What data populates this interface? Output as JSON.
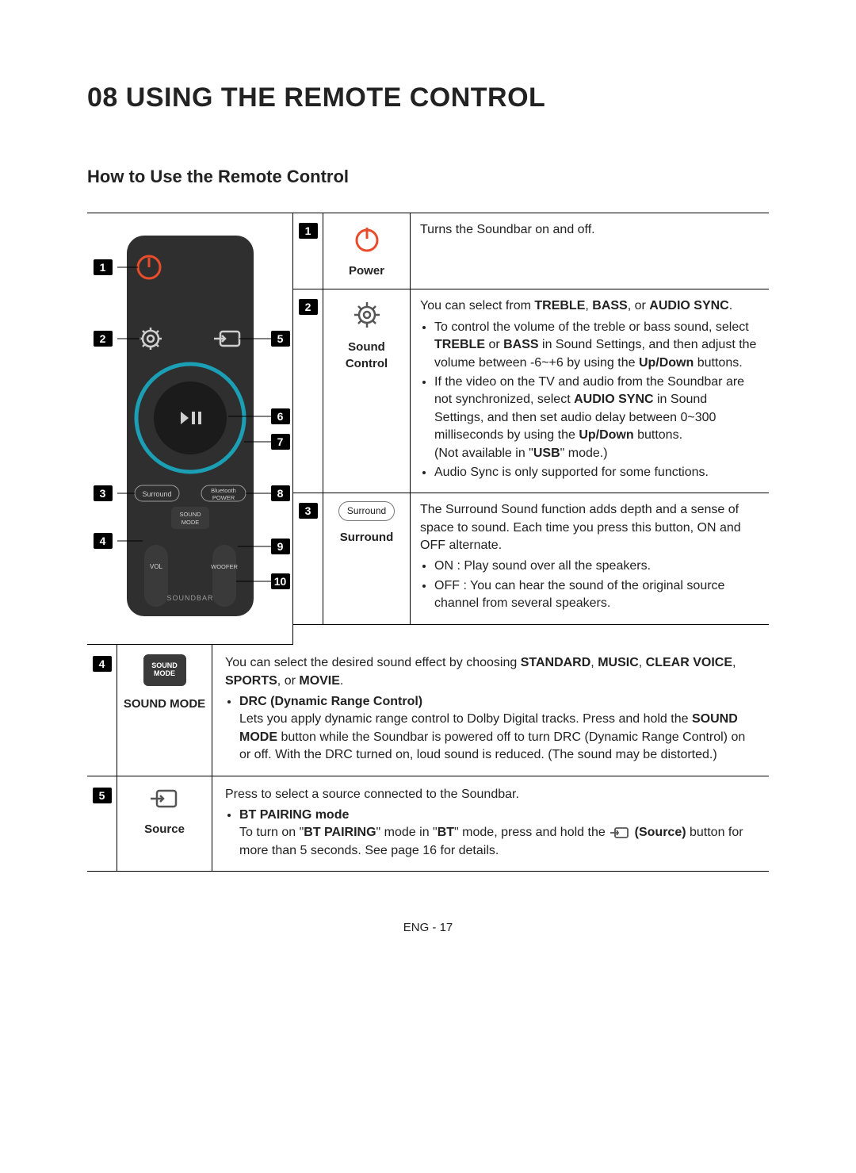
{
  "title": "08 USING THE REMOTE CONTROL",
  "subtitle": "How to Use the Remote Control",
  "remote_labels": {
    "surround": "Surround",
    "bt_power": "Bluetooth POWER",
    "sound_mode": "SOUND MODE",
    "vol": "VOL",
    "woofer": "WOOFER",
    "soundbar": "SOUNDBAR"
  },
  "callouts": {
    "left": [
      "1",
      "2",
      "3",
      "4"
    ],
    "right": [
      "5",
      "6",
      "7",
      "8",
      "9",
      "10"
    ]
  },
  "rows": {
    "r1": {
      "num": "1",
      "label": "Power",
      "text": "Turns the Soundbar on and off."
    },
    "r2": {
      "num": "2",
      "label": "Sound Control",
      "intro_a": "You can select from ",
      "intro_b": "TREBLE",
      "intro_c": ", ",
      "intro_d": "BASS",
      "intro_e": ", or ",
      "intro_f": "AUDIO SYNC",
      "intro_g": ".",
      "b1a": "To control the volume of the treble or bass sound, select ",
      "b1b": "TREBLE",
      "b1c": " or ",
      "b1d": "BASS",
      "b1e": " in Sound Settings, and then adjust the volume between -6~+6 by using the ",
      "b1f": "Up/Down",
      "b1g": " buttons.",
      "b2a": "If the video on the TV and audio from the Soundbar are not synchronized, select ",
      "b2b": "AUDIO SYNC",
      "b2c": " in Sound Settings, and then set audio delay between 0~300 milliseconds by using the ",
      "b2d": "Up/Down",
      "b2e": " buttons.",
      "b2f": "(Not available in \"",
      "b2g": "USB",
      "b2h": "\" mode.)",
      "b3": "Audio Sync is only supported for some functions."
    },
    "r3": {
      "num": "3",
      "pill": "Surround",
      "label": "Surround",
      "intro": "The Surround Sound function adds depth and a sense of space to sound. Each time you press this button, ON and OFF alternate.",
      "b1": "ON : Play sound over all the speakers.",
      "b2": "OFF : You can hear the sound of the original source channel from several speakers."
    },
    "r4": {
      "num": "4",
      "btn": "SOUND MODE",
      "label": "SOUND MODE",
      "intro_a": "You can select the desired sound effect by choosing ",
      "intro_b": "STANDARD",
      "intro_c": ", ",
      "intro_d": "MUSIC",
      "intro_e": ", ",
      "intro_f": "CLEAR VOICE",
      "intro_g": ", ",
      "intro_h": "SPORTS",
      "intro_i": ", or ",
      "intro_j": "MOVIE",
      "intro_k": ".",
      "b1t": "DRC (Dynamic Range Control)",
      "b1a": "Lets you apply dynamic range control to Dolby Digital tracks. Press and hold the ",
      "b1b": "SOUND MODE",
      "b1c": " button while the Soundbar is powered off to turn DRC (Dynamic Range Control) on or off. With the DRC turned on, loud sound is reduced. (The sound may be distorted.)"
    },
    "r5": {
      "num": "5",
      "label": "Source",
      "intro": "Press to select a source connected to the Soundbar.",
      "b1t": "BT PAIRING mode",
      "b1a": "To turn on \"",
      "b1b": "BT PAIRING",
      "b1c": "\" mode in \"",
      "b1d": "BT",
      "b1e": "\" mode, press and hold the ",
      "b1f": "(Source)",
      "b1g": " button for more than 5 seconds. See page 16 for details."
    }
  },
  "footer": "ENG - 17"
}
